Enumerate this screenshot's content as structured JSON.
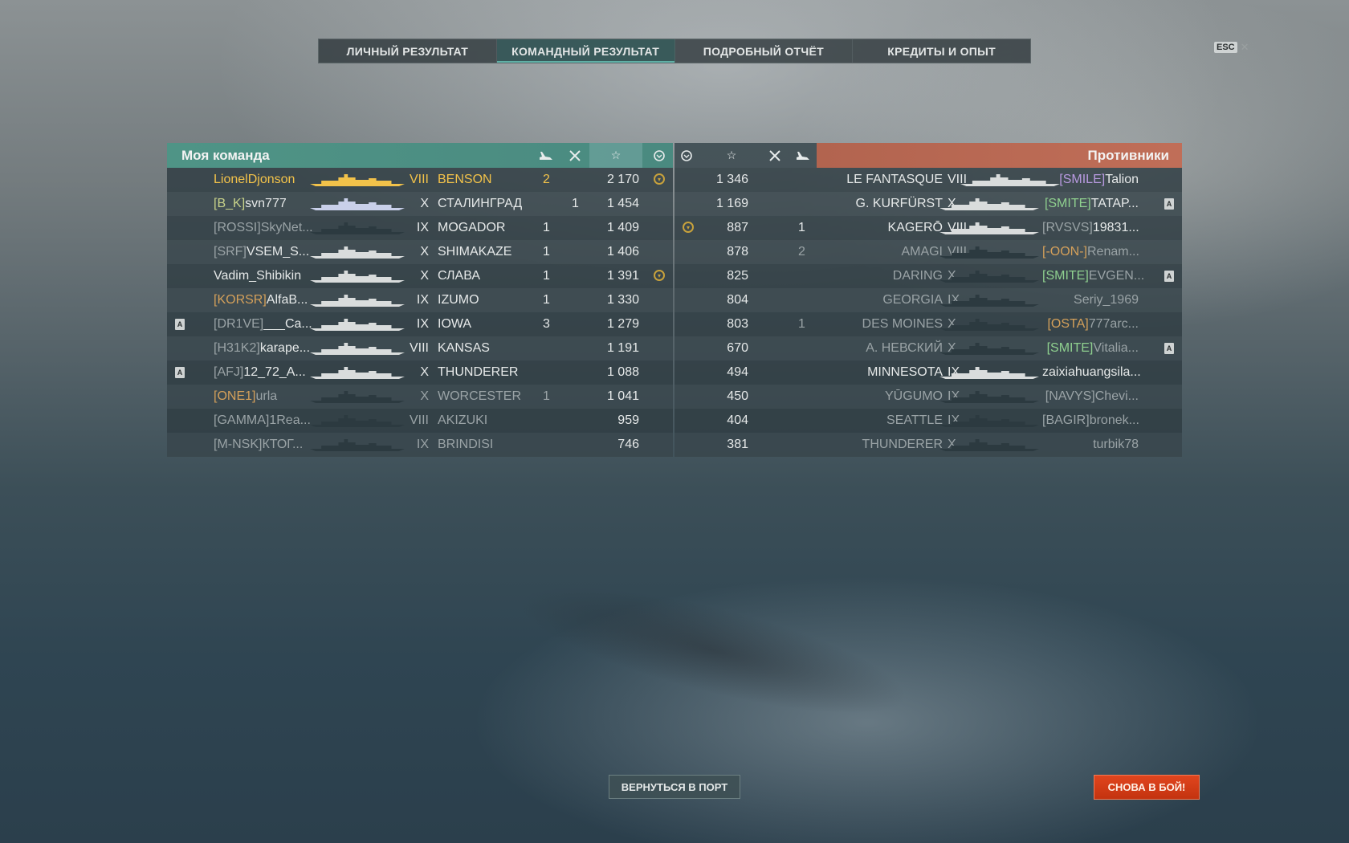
{
  "tabs": [
    {
      "label": "ЛИЧНЫЙ РЕЗУЛЬТАТ"
    },
    {
      "label": "КОМАНДНЫЙ РЕЗУЛЬТАТ"
    },
    {
      "label": "ПОДРОБНЫЙ ОТЧЁТ"
    },
    {
      "label": "КРЕДИТЫ И ОПЫТ"
    }
  ],
  "active_tab": "КОМАНДНЫЙ РЕЗУЛЬТАТ",
  "esc": {
    "key": "ESC",
    "close": "✕"
  },
  "my_team": {
    "title": "Моя команда",
    "header_icons": [
      "plane-icon",
      "crossed-swords-icon",
      "star-icon",
      "medal-icon"
    ],
    "rows": [
      {
        "clan": "",
        "name": "LionelDjonson",
        "tier": "VIII",
        "ship": "BENSON",
        "col1": "2",
        "col2": "",
        "xp": "2 170",
        "medal": true,
        "badge": false,
        "style": "me"
      },
      {
        "clan": "[B_K]",
        "name": "svn777",
        "tier": "X",
        "ship": "СТАЛИНГРАД",
        "col1": "",
        "col2": "1",
        "xp": "1 454",
        "medal": false,
        "badge": false,
        "style": "normal",
        "clan_color": "yellowgreen"
      },
      {
        "clan": "[ROSSI]",
        "name": "SkyNet...",
        "tier": "IX",
        "ship": "MOGADOR",
        "col1": "1",
        "col2": "",
        "xp": "1 409",
        "medal": false,
        "badge": false,
        "style": "dimname"
      },
      {
        "clan": "[SRF]",
        "name": "VSEM_S...",
        "tier": "X",
        "ship": "SHIMAKAZE",
        "col1": "1",
        "col2": "",
        "xp": "1 406",
        "medal": false,
        "badge": false,
        "style": "normal"
      },
      {
        "clan": "",
        "name": "Vadim_Shibikin",
        "tier": "X",
        "ship": "СЛАВА",
        "col1": "1",
        "col2": "",
        "xp": "1 391",
        "medal": true,
        "badge": false,
        "style": "normal"
      },
      {
        "clan": "[KORSR]",
        "name": "AlfaB...",
        "tier": "IX",
        "ship": "IZUMO",
        "col1": "1",
        "col2": "",
        "xp": "1 330",
        "medal": false,
        "badge": false,
        "style": "normal",
        "clan_color": "gold"
      },
      {
        "clan": "[DR1VE]",
        "name": "___Ca...",
        "tier": "IX",
        "ship": "IOWA",
        "col1": "3",
        "col2": "",
        "xp": "1 279",
        "medal": false,
        "badge": true,
        "style": "normal"
      },
      {
        "clan": "[H31K2]",
        "name": "karape...",
        "tier": "VIII",
        "ship": "KANSAS",
        "col1": "",
        "col2": "",
        "xp": "1 191",
        "medal": false,
        "badge": false,
        "style": "normal"
      },
      {
        "clan": "[AFJ]",
        "name": "12_72_A...",
        "tier": "X",
        "ship": "THUNDERER",
        "col1": "",
        "col2": "",
        "xp": "1 088",
        "medal": false,
        "badge": true,
        "style": "normal"
      },
      {
        "clan": "[ONE1]",
        "name": "urla",
        "tier": "X",
        "ship": "WORCESTER",
        "col1": "1",
        "col2": "",
        "xp": "1 041",
        "medal": false,
        "badge": false,
        "style": "dead",
        "clan_color": "gold"
      },
      {
        "clan": "[GAMMA]",
        "name": "1Rea...",
        "tier": "VIII",
        "ship": "AKIZUKI",
        "col1": "",
        "col2": "",
        "xp": "959",
        "medal": false,
        "badge": false,
        "style": "dead"
      },
      {
        "clan": "[M-NSK]",
        "name": "КТОГ...",
        "tier": "IX",
        "ship": "BRINDISI",
        "col1": "",
        "col2": "",
        "xp": "746",
        "medal": false,
        "badge": false,
        "style": "dead"
      }
    ]
  },
  "enemy_team": {
    "title": "Противники",
    "header_icons": [
      "medal-icon",
      "star-icon",
      "crossed-swords-icon",
      "plane-icon"
    ],
    "rows": [
      {
        "xp": "1 346",
        "col1": "",
        "ship": "LE FANTASQUE",
        "tier": "VIII",
        "clan": "[SMILE]",
        "name": "Talion",
        "medal": false,
        "badge": false,
        "style": "normal",
        "clan_color": "purple"
      },
      {
        "xp": "1 169",
        "col1": "",
        "ship": "G. KURFÜRST",
        "tier": "X",
        "clan": "[SMITE]",
        "name": "TATAP...",
        "medal": false,
        "badge": true,
        "style": "normal",
        "clan_color": "green"
      },
      {
        "xp": "887",
        "col1": "1",
        "ship": "KAGERŌ",
        "tier": "VIII",
        "clan": "[RVSVS]",
        "name": "19831...",
        "medal": true,
        "badge": false,
        "style": "normal"
      },
      {
        "xp": "878",
        "col1": "2",
        "ship": "AMAGI",
        "tier": "VIII",
        "clan": "[-OON-]",
        "name": "Renam...",
        "medal": false,
        "badge": false,
        "style": "dead",
        "clan_color": "gold"
      },
      {
        "xp": "825",
        "col1": "",
        "ship": "DARING",
        "tier": "X",
        "clan": "[SMITE]",
        "name": "EVGEN...",
        "medal": false,
        "badge": true,
        "style": "dead",
        "clan_color": "green"
      },
      {
        "xp": "804",
        "col1": "",
        "ship": "GEORGIA",
        "tier": "IX",
        "clan": "",
        "name": "Seriy_1969",
        "medal": false,
        "badge": false,
        "style": "dead"
      },
      {
        "xp": "803",
        "col1": "1",
        "ship": "DES MOINES",
        "tier": "X",
        "clan": "[OSTA]",
        "name": "777arc...",
        "medal": false,
        "badge": false,
        "style": "dead",
        "clan_color": "gold"
      },
      {
        "xp": "670",
        "col1": "",
        "ship": "А. НЕВСКИЙ",
        "tier": "X",
        "clan": "[SMITE]",
        "name": "Vitalia...",
        "medal": false,
        "badge": true,
        "style": "dead",
        "clan_color": "green"
      },
      {
        "xp": "494",
        "col1": "",
        "ship": "MINNESOTA",
        "tier": "IX",
        "clan": "",
        "name": "zaixiahuangsila...",
        "medal": false,
        "badge": false,
        "style": "normal"
      },
      {
        "xp": "450",
        "col1": "",
        "ship": "YŪGUMO",
        "tier": "IX",
        "clan": "[NAVYS]",
        "name": "Chevi...",
        "medal": false,
        "badge": false,
        "style": "dead"
      },
      {
        "xp": "404",
        "col1": "",
        "ship": "SEATTLE",
        "tier": "IX",
        "clan": "[BAGIR]",
        "name": "bronek...",
        "medal": false,
        "badge": false,
        "style": "dead"
      },
      {
        "xp": "381",
        "col1": "",
        "ship": "THUNDERER",
        "tier": "X",
        "clan": "",
        "name": "turbik78",
        "medal": false,
        "badge": false,
        "style": "dead"
      }
    ]
  },
  "buttons": {
    "port": "ВЕРНУТЬСЯ В ПОРТ",
    "battle": "СНОВА В БОЙ!"
  },
  "colors": {
    "my_team_header": "#4f9486",
    "enemy_team_header": "#c06e58",
    "me_highlight": "#f2c24a",
    "battle_button": "#d63c15"
  }
}
